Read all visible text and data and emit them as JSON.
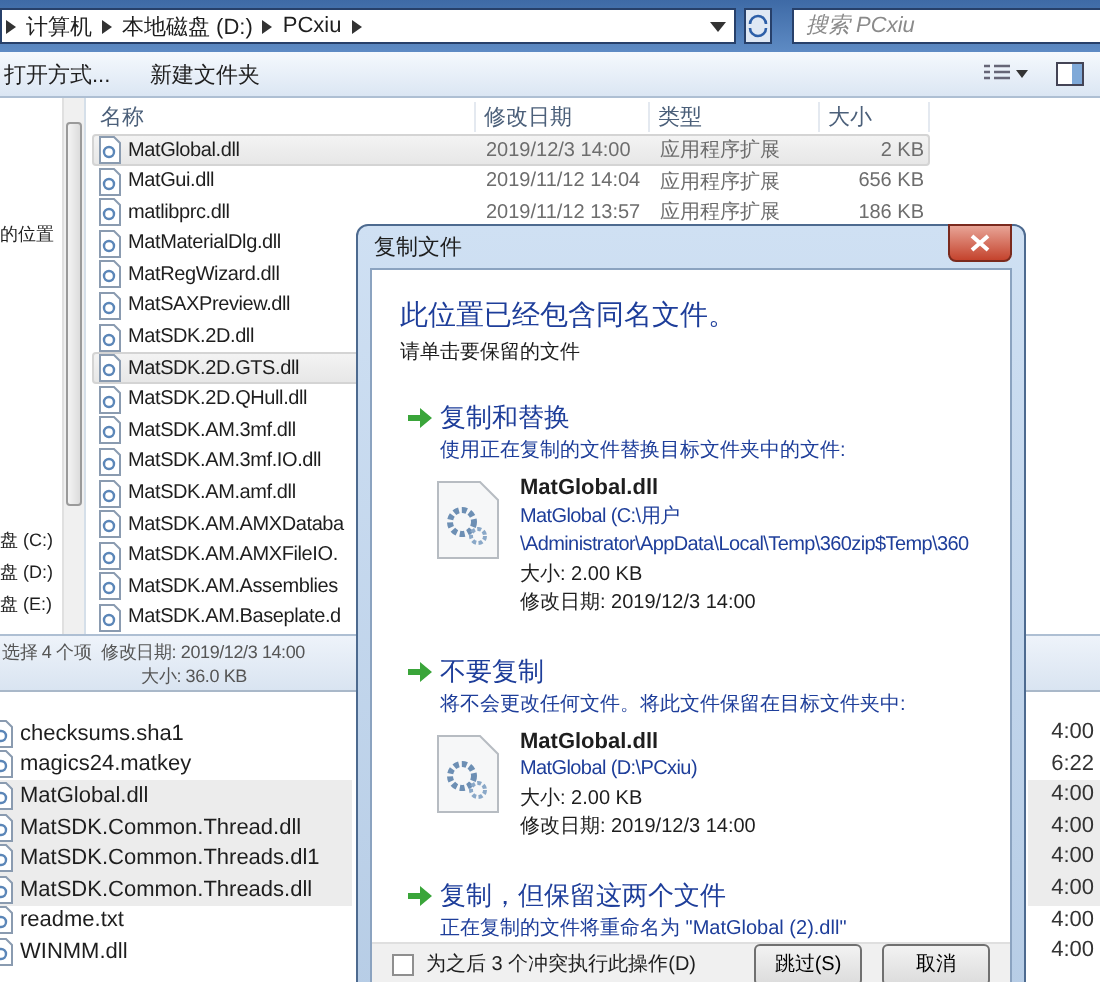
{
  "explorer": {
    "breadcrumb": [
      "计算机",
      "本地磁盘 (D:)",
      "PCxiu"
    ],
    "search": {
      "placeholder": "搜索 PCxiu"
    },
    "toolbar": [
      "打开方式...",
      "新建文件夹"
    ],
    "nav_items": [
      "的位置",
      "盘 (C:)",
      "盘 (D:)",
      "盘 (E:)"
    ],
    "columns": [
      "名称",
      "修改日期",
      "类型",
      "大小"
    ],
    "rows": [
      {
        "name": "MatGlobal.dll",
        "date": "2019/12/3 14:00",
        "type": "应用程序扩展",
        "size": "2 KB",
        "selected": true
      },
      {
        "name": "MatGui.dll",
        "date": "2019/11/12 14:04",
        "type": "应用程序扩展",
        "size": "656 KB",
        "selected": false
      },
      {
        "name": "matlibprc.dll",
        "date": "2019/11/12 13:57",
        "type": "应用程序扩展",
        "size": "186 KB",
        "selected": false
      },
      {
        "name": "MatMaterialDlg.dll",
        "selected": false
      },
      {
        "name": "MatRegWizard.dll",
        "selected": false
      },
      {
        "name": "MatSAXPreview.dll",
        "selected": false
      },
      {
        "name": "MatSDK.2D.dll",
        "selected": false
      },
      {
        "name": "MatSDK.2D.GTS.dll",
        "selected": true
      },
      {
        "name": "MatSDK.2D.QHull.dll",
        "selected": false
      },
      {
        "name": "MatSDK.AM.3mf.dll",
        "selected": false
      },
      {
        "name": "MatSDK.AM.3mf.IO.dll",
        "selected": false
      },
      {
        "name": "MatSDK.AM.amf.dll",
        "selected": false
      },
      {
        "name": "MatSDK.AM.AMXDataba",
        "selected": false
      },
      {
        "name": "MatSDK.AM.AMXFileIO.",
        "selected": false
      },
      {
        "name": "MatSDK.AM.Assemblies",
        "selected": false
      },
      {
        "name": "MatSDK.AM.Baseplate.d",
        "selected": false
      }
    ],
    "status": {
      "selection": "选择 4 个项",
      "modified": "修改日期: 2019/12/3 14:00",
      "size": "大小: 36.0 KB"
    }
  },
  "back_window": {
    "rows": [
      {
        "name": "checksums.sha1",
        "time": "4:00",
        "selected": false
      },
      {
        "name": "magics24.matkey",
        "time": "6:22",
        "selected": false
      },
      {
        "name": "MatGlobal.dll",
        "time": "4:00",
        "selected": true
      },
      {
        "name": "MatSDK.Common.Thread.dll",
        "time": "4:00",
        "selected": true
      },
      {
        "name": "MatSDK.Common.Threads.dl1",
        "time": "4:00",
        "selected": true
      },
      {
        "name": "MatSDK.Common.Threads.dll",
        "time": "4:00",
        "selected": true
      },
      {
        "name": "readme.txt",
        "time": "4:00",
        "selected": false
      },
      {
        "name": "WINMM.dll",
        "time": "4:00",
        "selected": false
      }
    ]
  },
  "dialog": {
    "title": "复制文件",
    "heading": "此位置已经包含同名文件。",
    "instruction": "请单击要保留的文件",
    "options": [
      {
        "title": "复制和替换",
        "description": "使用正在复制的文件替换目标文件夹中的文件:",
        "file": {
          "name": "MatGlobal.dll",
          "location": [
            "MatGlobal (C:\\用户",
            "\\Administrator\\AppData\\Local\\Temp\\360zip$Temp\\360"
          ],
          "size": "大小: 2.00 KB",
          "modified": "修改日期: 2019/12/3 14:00"
        }
      },
      {
        "title": "不要复制",
        "description": "将不会更改任何文件。将此文件保留在目标文件夹中:",
        "file": {
          "name": "MatGlobal.dll",
          "location": [
            "MatGlobal (D:\\PCxiu)"
          ],
          "size": "大小: 2.00 KB",
          "modified": "修改日期: 2019/12/3 14:00"
        }
      },
      {
        "title": "复制，但保留这两个文件",
        "description": "正在复制的文件将重命名为 \"MatGlobal (2).dll\""
      }
    ],
    "apply_all": {
      "label": "为之后 3 个冲突执行此操作(D)",
      "checked": false
    },
    "buttons": [
      "跳过(S)",
      "取消"
    ]
  }
}
